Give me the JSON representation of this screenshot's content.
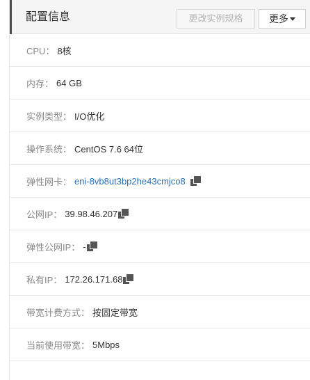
{
  "header": {
    "title": "配置信息",
    "change_spec_label": "更改实例规格",
    "more_label": "更多"
  },
  "rows": [
    {
      "label": "CPU：",
      "value": "8核"
    },
    {
      "label": "内存：",
      "value": "64 GB"
    },
    {
      "label": "实例类型：",
      "value": "I/O优化"
    },
    {
      "label": "操作系统：",
      "value": "CentOS 7.6 64位"
    },
    {
      "label": "弹性网卡：",
      "value": "eni-8vb8ut3bp2he43cmjco8"
    },
    {
      "label": "公网IP：",
      "value": "39.98.46.207"
    },
    {
      "label": "弹性公网IP：",
      "value": "-"
    },
    {
      "label": "私有IP：",
      "value": "172.26.171.68"
    },
    {
      "label": "带宽计费方式：",
      "value": "按固定带宽"
    },
    {
      "label": "当前使用带宽：",
      "value": "5Mbps"
    }
  ],
  "icons": {
    "copy": "copy-icon",
    "dropdown": "caret-down-icon"
  },
  "colors": {
    "accent": "#4d4d4d",
    "link": "#2a6fb8",
    "label": "#888888",
    "value": "#333333"
  }
}
